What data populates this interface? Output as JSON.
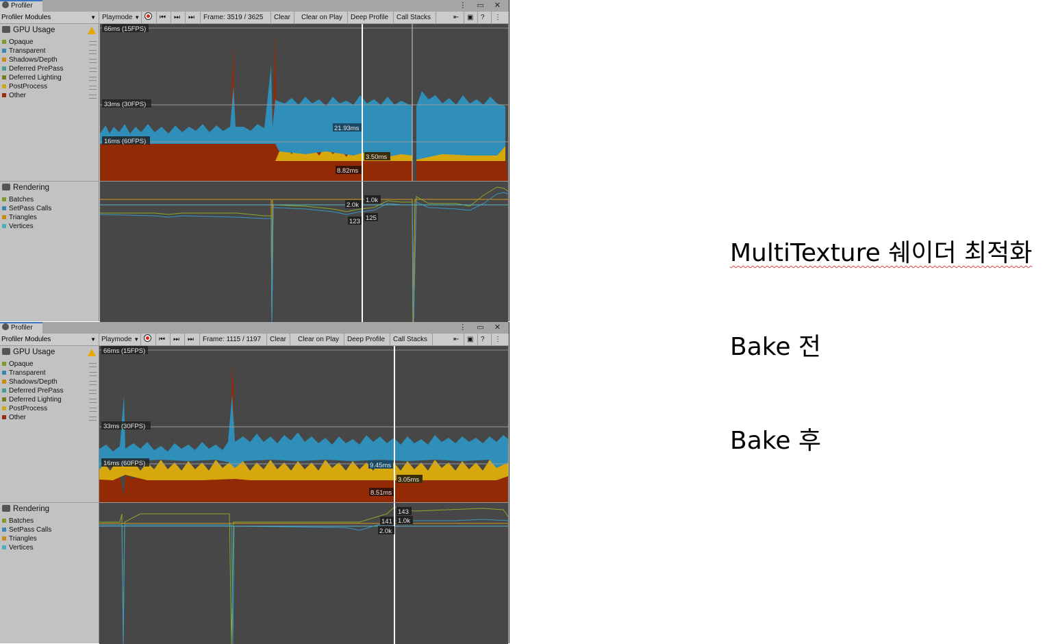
{
  "panels": [
    {
      "tab_label": "Profiler",
      "modules_dropdown": "Profiler Modules",
      "toolbar": {
        "playmode": "Playmode",
        "frame": "Frame: 3519 / 3625",
        "clear": "Clear",
        "clear_on_play": "Clear on Play",
        "deep_profile": "Deep Profile",
        "call_stacks": "Call Stacks"
      },
      "gpu_module": {
        "title": "GPU Usage",
        "legend": [
          "Opaque",
          "Transparent",
          "Shadows/Depth",
          "Deferred PrePass",
          "Deferred Lighting",
          "PostProcess",
          "Other"
        ],
        "fps_labels": [
          "66ms (15FPS)",
          "33ms (30FPS)",
          "16ms (60FPS)"
        ],
        "value_labels": [
          "21.93ms",
          "3.50ms",
          "8.82ms"
        ]
      },
      "rendering_module": {
        "title": "Rendering",
        "legend": [
          "Batches",
          "SetPass Calls",
          "Triangles",
          "Vertices"
        ],
        "value_labels": [
          "2.0k",
          "1.0k",
          "123",
          "125"
        ]
      }
    },
    {
      "tab_label": "Profiler",
      "modules_dropdown": "Profiler Modules",
      "toolbar": {
        "playmode": "Playmode",
        "frame": "Frame: 1115 / 1197",
        "clear": "Clear",
        "clear_on_play": "Clear on Play",
        "deep_profile": "Deep Profile",
        "call_stacks": "Call Stacks"
      },
      "gpu_module": {
        "title": "GPU Usage",
        "legend": [
          "Opaque",
          "Transparent",
          "Shadows/Depth",
          "Deferred PrePass",
          "Deferred Lighting",
          "PostProcess",
          "Other"
        ],
        "fps_labels": [
          "66ms (15FPS)",
          "33ms (30FPS)",
          "16ms (60FPS)"
        ],
        "value_labels": [
          "9.45ms",
          "3.05ms",
          "8.51ms"
        ]
      },
      "rendering_module": {
        "title": "Rendering",
        "legend": [
          "Batches",
          "SetPass Calls",
          "Triangles",
          "Vertices"
        ],
        "value_labels": [
          "143",
          "1.0k",
          "141",
          "2.0k"
        ]
      }
    }
  ],
  "legend_colors": {
    "gpu": [
      "#7a9a2a",
      "#3a86b4",
      "#c98a1a",
      "#4a9a9a",
      "#7a7a1e",
      "#c9a81a",
      "#9a2a10"
    ],
    "rendering": [
      "#7a9a2a",
      "#3a86b4",
      "#c98a1a",
      "#4ab0c0"
    ]
  },
  "series_colors": {
    "blue": "#2f8fb8",
    "yellow": "#d7a80e",
    "red": "#922a06"
  },
  "annotations": {
    "title": "MultiTexture 쉐이더 최적화",
    "before": "Bake 전",
    "after": "Bake 후"
  }
}
